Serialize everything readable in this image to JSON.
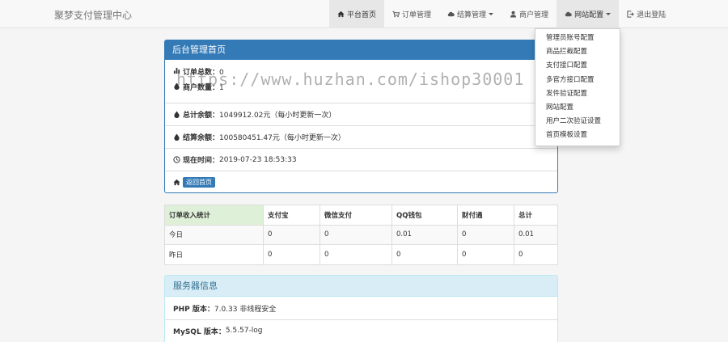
{
  "navbar": {
    "brand": "聚梦支付管理中心",
    "items": [
      {
        "label": "平台首页",
        "icon": "home-icon"
      },
      {
        "label": "订单管理",
        "icon": "cart-icon"
      },
      {
        "label": "结算管理",
        "icon": "cloud-icon"
      },
      {
        "label": "商户管理",
        "icon": "user-icon"
      },
      {
        "label": "网站配置",
        "icon": "cloud-icon"
      },
      {
        "label": "退出登陆",
        "icon": "logout-icon"
      }
    ]
  },
  "dropdown": {
    "items": [
      "管理员账号配置",
      "商品拦截配置",
      "支付接口配置",
      "多官方接口配置",
      "发件验证配置",
      "网站配置",
      "用户二次验证设置",
      "首页模板设置"
    ]
  },
  "admin_panel": {
    "title": "后台管理首页",
    "order_total_label": "订单总数：",
    "order_total": "0",
    "merchant_count_label": "商户数量：",
    "merchant_count": "1",
    "total_balance_label": "总计余额：",
    "total_balance": "1049912.02元（每小时更新一次）",
    "settle_balance_label": "结算余额：",
    "settle_balance": "100580451.47元（每小时更新一次）",
    "now_label": "现在时间：",
    "now": "2019-07-23 18:53:33",
    "back_button": "返回首页"
  },
  "stats_table": {
    "headers": [
      "订单收入统计",
      "支付宝",
      "微信支付",
      "QQ钱包",
      "财付通",
      "总计"
    ],
    "rows": [
      [
        "今日",
        "0",
        "0",
        "0.01",
        "0",
        "0.01"
      ],
      [
        "昨日",
        "0",
        "0",
        "0",
        "0",
        "0"
      ]
    ]
  },
  "server_panel": {
    "title": "服务器信息",
    "php_label": "PHP 版本：",
    "php_value": "7.0.33 非线程安全",
    "mysql_label": "MySQL 版本：",
    "mysql_value": "5.5.57-log"
  },
  "watermark": "https://www.huzhan.com/ishop30001",
  "colors": {
    "primary": "#337ab7",
    "info_bg": "#d9edf7",
    "info_text": "#31708f",
    "success_bg": "#dff0d8"
  }
}
